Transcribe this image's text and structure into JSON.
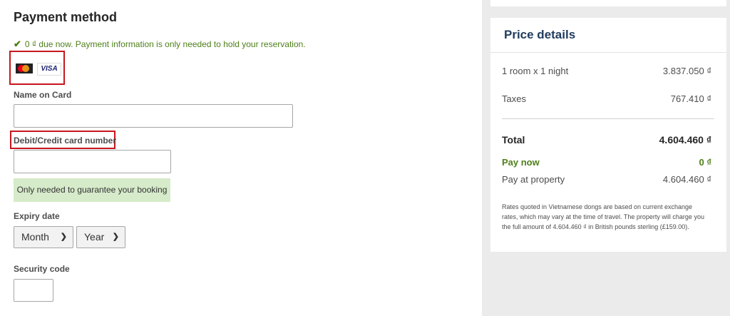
{
  "payment": {
    "title": "Payment method",
    "due_message": "0 ₫ due now. Payment information is only needed to hold your reservation.",
    "card_brands": [
      "mastercard-icon",
      "visa-icon"
    ],
    "visa_text": "VISA",
    "name_label": "Name on Card",
    "name_value": "",
    "card_number_label": "Debit/Credit card number",
    "card_number_value": "",
    "guarantee_note": "Only needed to guarantee your booking",
    "expiry_label": "Expiry date",
    "month_selected": "Month",
    "year_selected": "Year",
    "security_label": "Security code",
    "security_value": ""
  },
  "price": {
    "title": "Price details",
    "rows": [
      {
        "label": "1 room x 1 night",
        "value": "3.837.050 ₫"
      },
      {
        "label": "Taxes",
        "value": "767.410 ₫"
      }
    ],
    "total": {
      "label": "Total",
      "value": "4.604.460 ₫"
    },
    "pay_now": {
      "label": "Pay now",
      "value": "0 ₫"
    },
    "pay_at_property": {
      "label": "Pay at property",
      "value": "4.604.460 ₫"
    },
    "note": "Rates quoted in Vietnamese dongs are based on current exchange rates, which may vary at the time of travel. The property will charge you the full amount of 4.604.460 ₫ in British pounds sterling (£159.00)."
  },
  "colors": {
    "highlight": "#c8161d",
    "green": "#4e7f1a",
    "header_blue": "#213c5e"
  }
}
